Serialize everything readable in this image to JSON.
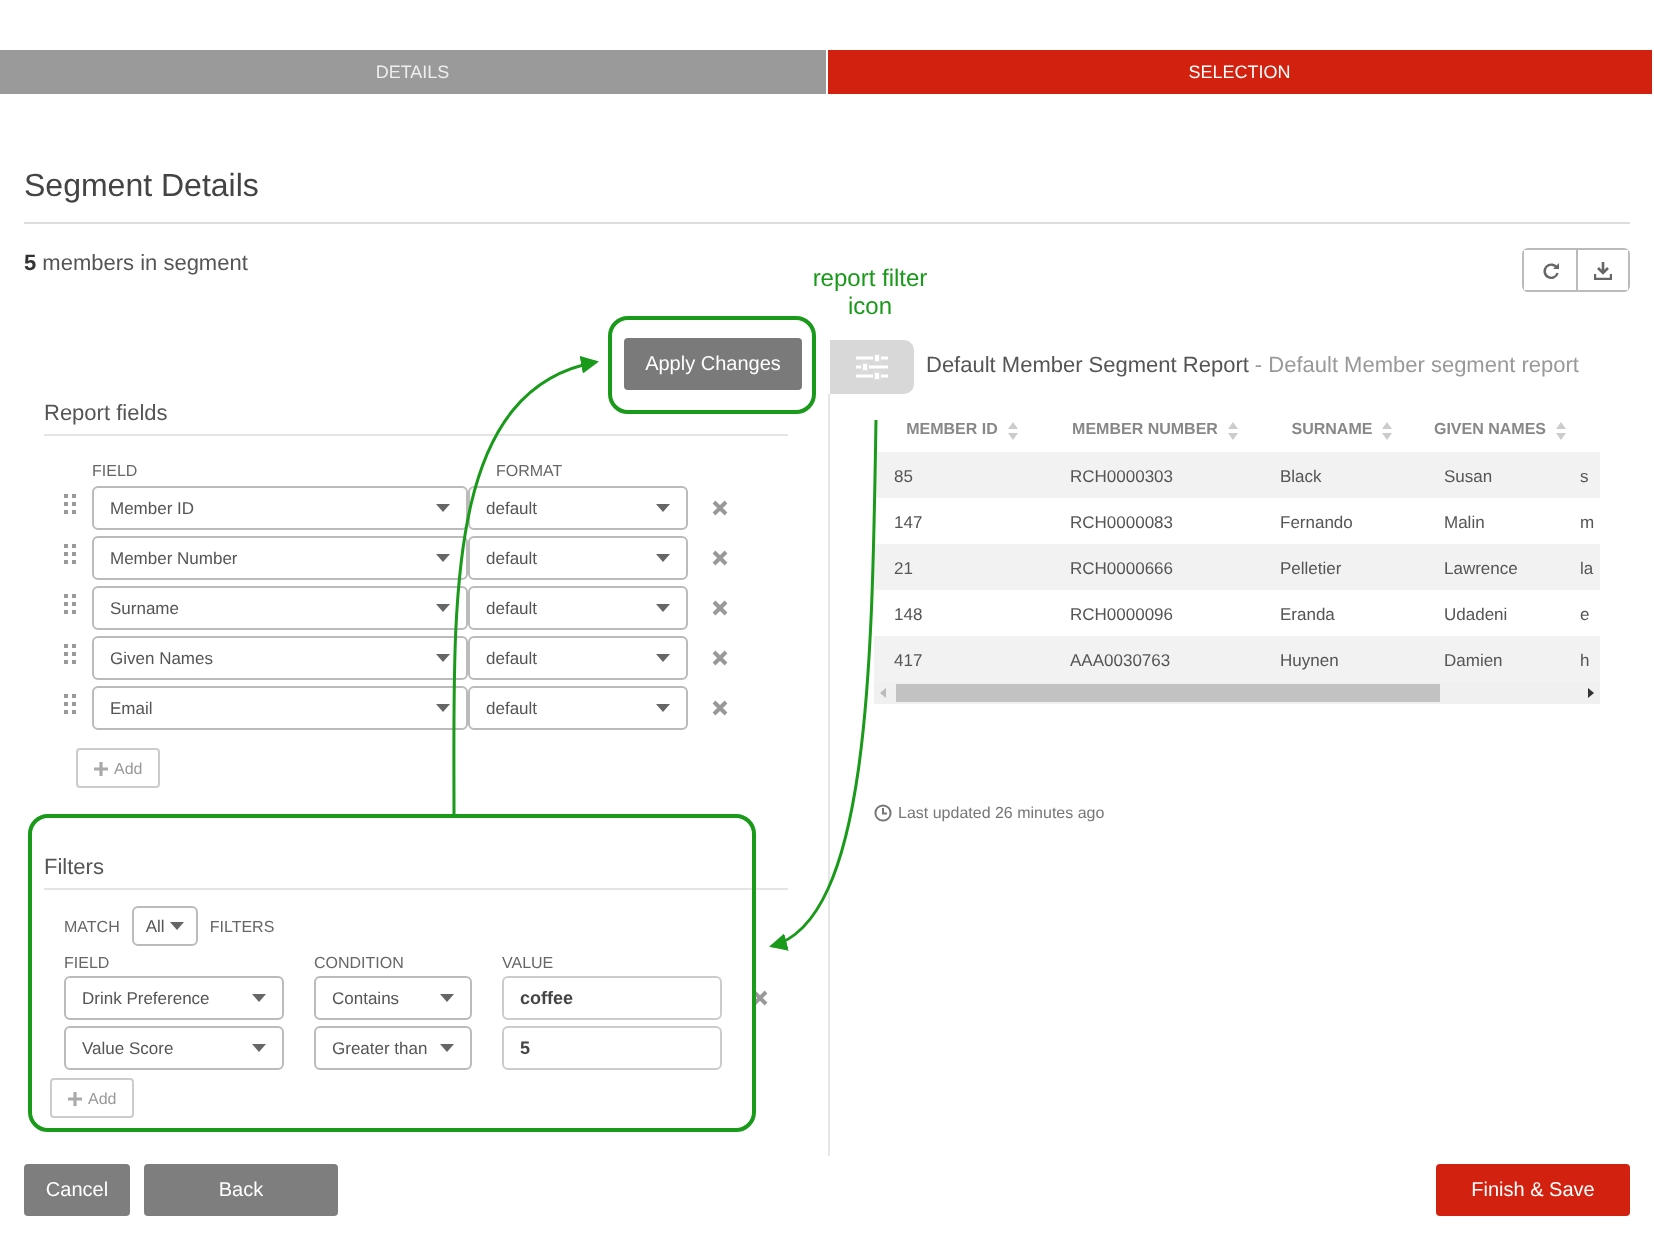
{
  "steps": [
    {
      "label": "DETAILS",
      "selected": false
    },
    {
      "label": "SELECTION",
      "selected": true
    }
  ],
  "title": "Segment Details",
  "summary": "**5** members in segment",
  "apply_button": "Apply Changes",
  "report_fields": {
    "title": "Report fields",
    "columns": [
      "FIELD",
      "FORMAT"
    ],
    "rows": [
      {
        "field": "Member ID",
        "format": "default"
      },
      {
        "field": "Member Number",
        "format": "default"
      },
      {
        "field": "Surname",
        "format": "default"
      },
      {
        "field": "Given Names",
        "format": "default"
      },
      {
        "field": "Email",
        "format": "default"
      }
    ],
    "add_button": "Add"
  },
  "filters": {
    "title": "Filters",
    "match_label": "MATCH",
    "match_value": "All",
    "match_suffix": "FILTERS",
    "columns": [
      "FIELD",
      "CONDITION",
      "VALUE"
    ],
    "rows": [
      {
        "field": "Drink Preference",
        "condition": "Contains",
        "value": "coffee",
        "remove_icon": true
      },
      {
        "field": "Value Score",
        "condition": "Greater than",
        "value": "5",
        "remove_icon": false
      }
    ],
    "add_button": "Add"
  },
  "report": {
    "name": "Default Member Segment Report",
    "description": "- Default Member segment report",
    "table": {
      "columns": [
        "MEMBER ID",
        "MEMBER NUMBER",
        "SURNAME",
        "GIVEN NAMES"
      ],
      "rows": [
        [
          "85",
          "RCH0000303",
          "Black",
          "Susan",
          "s"
        ],
        [
          "147",
          "RCH0000083",
          "Fernando",
          "Malin",
          "m"
        ],
        [
          "21",
          "RCH0000666",
          "Pelletier",
          "Lawrence",
          "la"
        ],
        [
          "148",
          "RCH0000096",
          "Eranda",
          "Udadeni",
          "e"
        ],
        [
          "417",
          "AAA0030763",
          "Huynen",
          "Damien",
          "h"
        ]
      ]
    },
    "last_updated": "Last updated 26 minutes ago"
  },
  "footer": {
    "cancel": "Cancel",
    "back": "Back",
    "finish": "Finish & Save"
  },
  "annotation": {
    "label": "report filter icon"
  }
}
